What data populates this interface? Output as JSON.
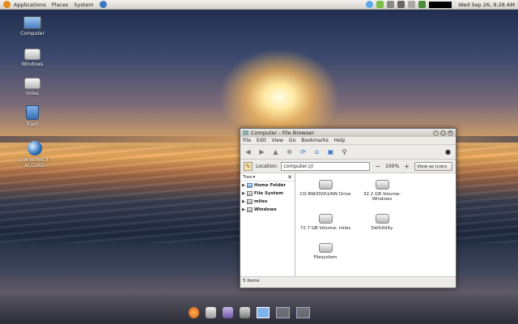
{
  "top_panel": {
    "menus": [
      "Applications",
      "Places",
      "System"
    ],
    "clock": "Wed Sep 26,  9:28 AM"
  },
  "desktop_icons": [
    {
      "label": "Computer",
      "icon": "computer-icon"
    },
    {
      "label": "Windows",
      "icon": "drive-icon"
    },
    {
      "label": "miles",
      "icon": "drive-icon"
    },
    {
      "label": "Trash",
      "icon": "trash-icon"
    },
    {
      "label": "Link to Wk 3 - ACCORD",
      "icon": "globe-icon"
    }
  ],
  "window": {
    "title": "Computer - File Browser",
    "menus": [
      "File",
      "Edit",
      "View",
      "Go",
      "Bookmarks",
      "Help"
    ],
    "location_label": "Location:",
    "location_value": "computer:///",
    "zoom": "100%",
    "view_mode": "View as Icons",
    "sidebar": {
      "header": "Tree",
      "items": [
        "Home Folder",
        "File System",
        "miles",
        "Windows"
      ]
    },
    "files": [
      "CD-RW/DVD±RW Drive",
      "32.2 GB Volume: Windows",
      "72.7 GB Volume: miles",
      "DellUtility",
      "Filesystem"
    ],
    "status": "5 items"
  },
  "colors": {
    "accent": "#2f6fc2",
    "panel": "#e6e3df"
  }
}
